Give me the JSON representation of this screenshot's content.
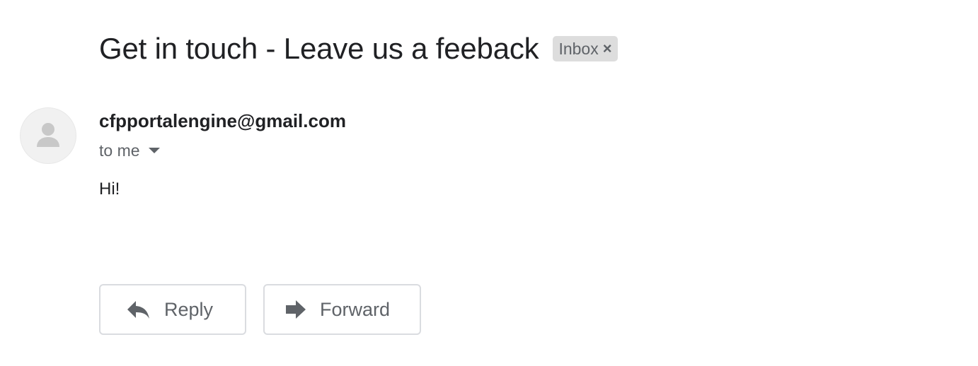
{
  "email": {
    "subject": "Get in touch - Leave us a feeback",
    "label": {
      "text": "Inbox",
      "remove_glyph": "×"
    },
    "sender": "cfpportalengine@gmail.com",
    "recipients": "to me",
    "body": "Hi!"
  },
  "actions": {
    "reply_label": "Reply",
    "forward_label": "Forward"
  },
  "icons": {
    "avatar": "person-icon",
    "recipients_toggle": "caret-down-icon",
    "reply": "reply-arrow-icon",
    "forward": "forward-arrow-icon",
    "label_remove": "close-icon"
  },
  "colors": {
    "text_primary": "#202124",
    "text_secondary": "#5f6368",
    "chip_background": "#dddddd",
    "button_border": "#dadce0",
    "avatar_background": "#f1f1f1",
    "avatar_glyph": "#c8c8c8"
  }
}
